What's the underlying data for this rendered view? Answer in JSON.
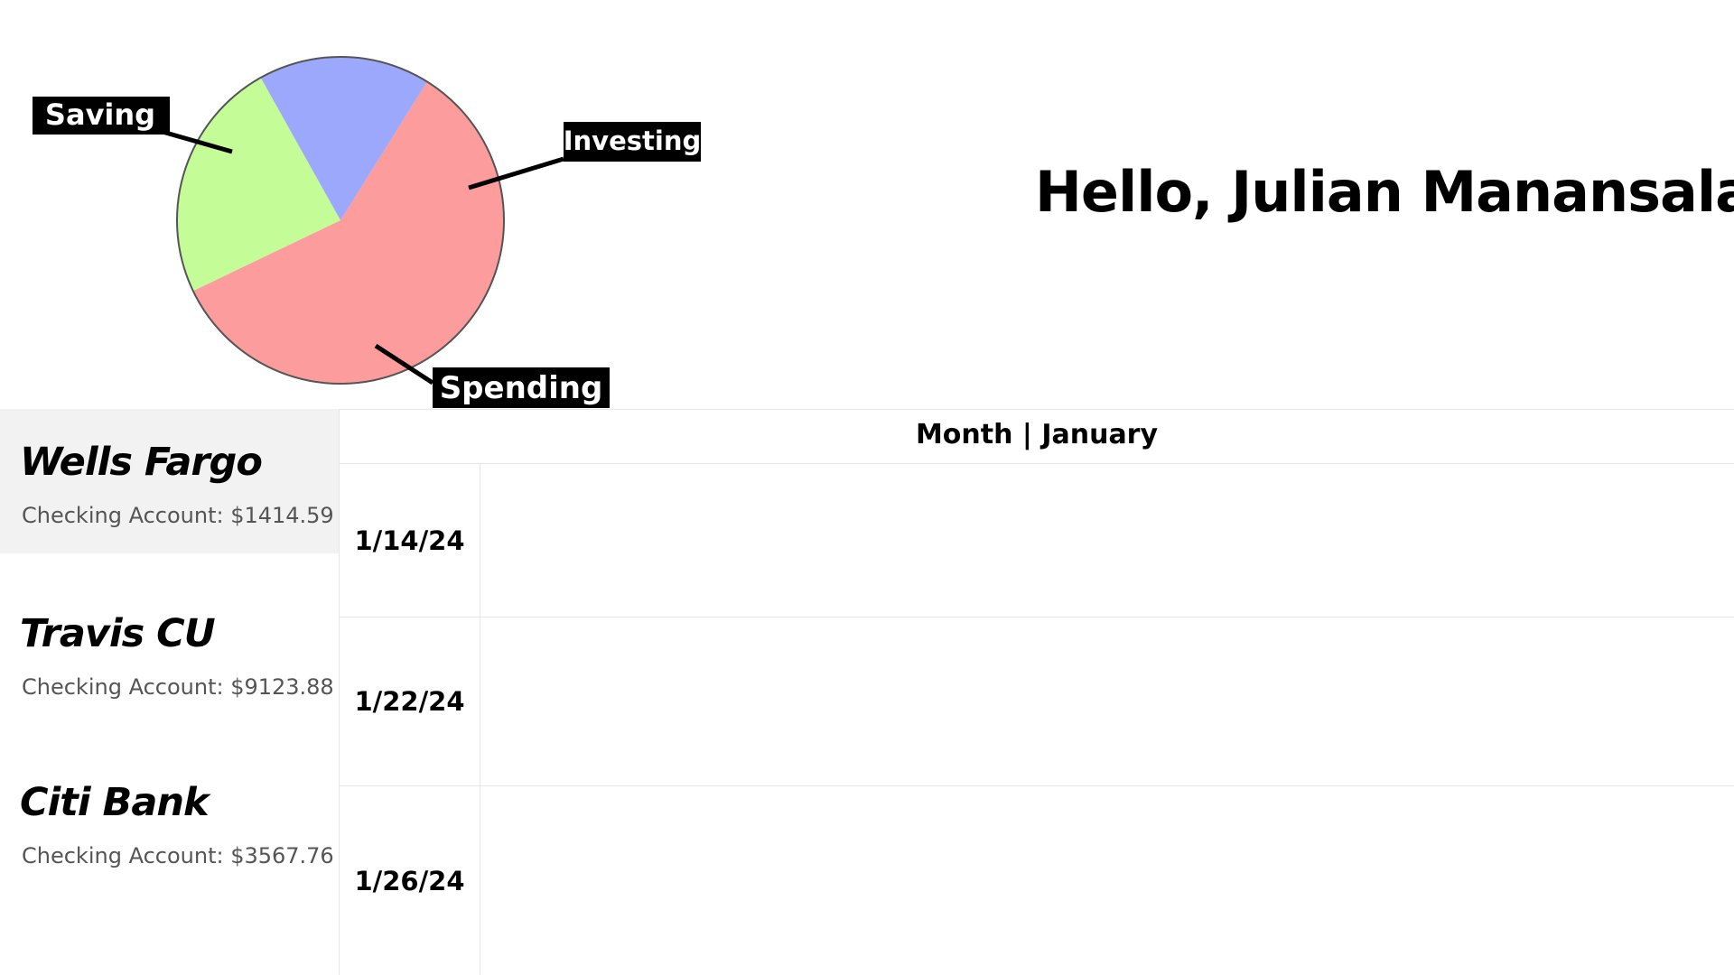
{
  "greeting": "Hello, Julian Manansala",
  "chart_data": {
    "type": "pie",
    "title": "",
    "labels": [
      "Saving",
      "Investing",
      "Spending"
    ],
    "values": [
      59,
      24,
      17
    ],
    "colors": [
      "#fc9c9c",
      "#c4fc98",
      "#9ca8fc"
    ],
    "start_angle_deg": -58
  },
  "accounts": [
    {
      "name": "Wells Fargo",
      "balance": "Checking Account: $1414.59",
      "selected": true
    },
    {
      "name": "Travis CU",
      "balance": "Checking Account: $9123.88",
      "selected": false
    },
    {
      "name": "Citi Bank",
      "balance": "Checking Account: $3567.76",
      "selected": false
    }
  ],
  "calendar": {
    "header": "Month | January",
    "dates": [
      "1/14/24",
      "1/22/24",
      "1/26/24"
    ]
  }
}
